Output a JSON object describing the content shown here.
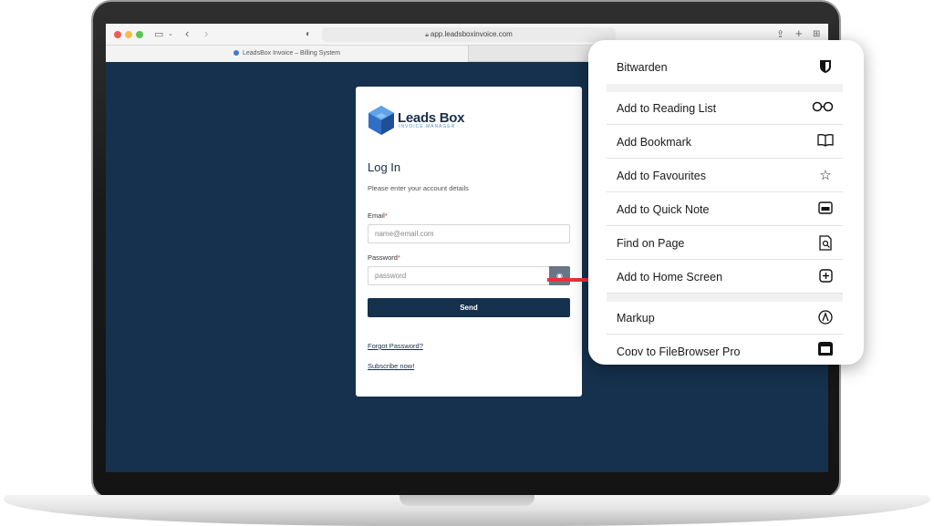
{
  "browser": {
    "url": "app.leadsboxinvoice.com",
    "tab_title": "LeadsBox Invoice – Billing System",
    "traffic_lights": [
      "#ec5e57",
      "#f4be4f",
      "#5ec454"
    ]
  },
  "login": {
    "brand_name": "Leads Box",
    "brand_tagline": "INVOICE MANAGER",
    "heading": "Log In",
    "subheading": "Please enter your account details",
    "email_label": "Email",
    "email_placeholder": "name@email.com",
    "password_label": "Password",
    "password_placeholder": "password",
    "required_mark": "*",
    "send_label": "Send",
    "forgot_link": "Forgot Password?",
    "subscribe_link": "Subscribe now!"
  },
  "share_menu": {
    "items": [
      {
        "label": "Bitwarden",
        "icon": "shield-icon"
      },
      {
        "label": "Add to Reading List",
        "icon": "glasses-icon"
      },
      {
        "label": "Add Bookmark",
        "icon": "book-icon"
      },
      {
        "label": "Add to Favourites",
        "icon": "star-icon"
      },
      {
        "label": "Add to Quick Note",
        "icon": "quick-note-icon"
      },
      {
        "label": "Find on Page",
        "icon": "find-page-icon"
      },
      {
        "label": "Add to Home Screen",
        "icon": "plus-square-icon"
      },
      {
        "label": "Markup",
        "icon": "markup-icon"
      },
      {
        "label": "Copy to FileBrowser Pro",
        "icon": "filebrowser-icon"
      }
    ]
  },
  "colors": {
    "screen_background": "#15314d",
    "highlight_arrow": "#e8323c",
    "brand_blue": "#4a8fd6"
  }
}
